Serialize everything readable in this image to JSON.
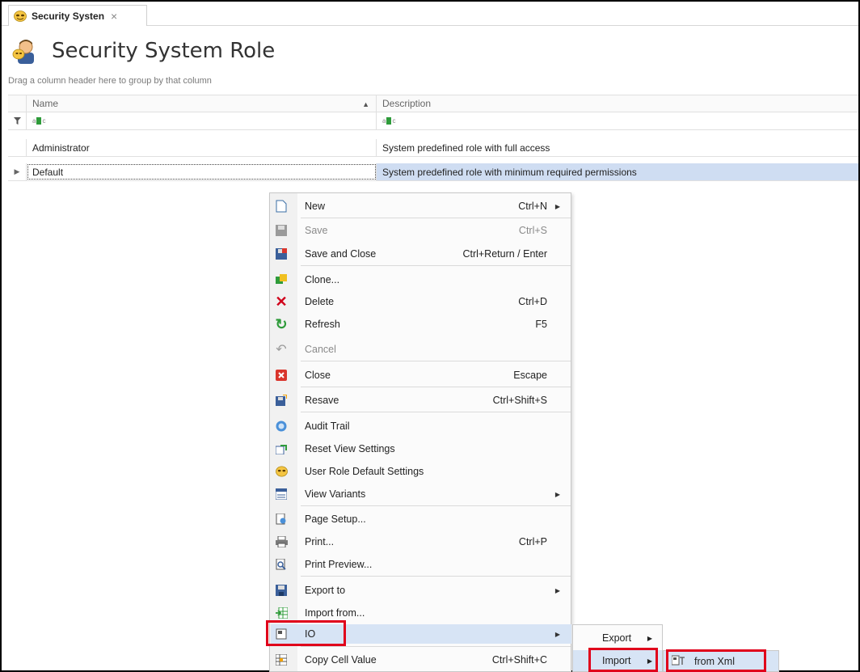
{
  "tab": {
    "label": "Security Systen",
    "close": "×"
  },
  "header": {
    "title": "Security System Role"
  },
  "group_panel": {
    "hint": "Drag a column header here to group by that column"
  },
  "grid": {
    "columns": [
      "Name",
      "Description"
    ],
    "filter_icon": "filter-icon",
    "rows": [
      {
        "name": "Administrator",
        "description": "System predefined role with full access"
      },
      {
        "name": "Default",
        "description": "System predefined role with minimum required permissions"
      }
    ]
  },
  "context_menu": {
    "items": [
      {
        "label": "New",
        "shortcut": "Ctrl+N",
        "submenu": true,
        "icon": "new-icon"
      },
      {
        "label": "Save",
        "shortcut": "Ctrl+S",
        "disabled": true,
        "icon": "save-icon"
      },
      {
        "label": "Save and Close",
        "shortcut": "Ctrl+Return / Enter",
        "icon": "save-close-icon"
      },
      {
        "label": "Clone...",
        "shortcut": "",
        "icon": "clone-icon"
      },
      {
        "label": "Delete",
        "shortcut": "Ctrl+D",
        "icon": "delete-icon"
      },
      {
        "label": "Refresh",
        "shortcut": "F5",
        "icon": "refresh-icon"
      },
      {
        "label": "Cancel",
        "shortcut": "",
        "disabled": true,
        "icon": "cancel-icon"
      },
      {
        "label": "Close",
        "shortcut": "Escape",
        "icon": "close-icon"
      },
      {
        "label": "Resave",
        "shortcut": "Ctrl+Shift+S",
        "icon": "resave-icon"
      },
      {
        "label": "Audit Trail",
        "shortcut": "",
        "icon": "audit-icon"
      },
      {
        "label": "Reset View Settings",
        "shortcut": "",
        "icon": "reset-view-icon"
      },
      {
        "label": "User Role Default Settings",
        "shortcut": "",
        "icon": "mask-icon"
      },
      {
        "label": "View Variants",
        "shortcut": "",
        "submenu": true,
        "icon": "view-variants-icon"
      },
      {
        "label": "Page Setup...",
        "shortcut": "",
        "icon": "page-setup-icon"
      },
      {
        "label": "Print...",
        "shortcut": "Ctrl+P",
        "icon": "print-icon"
      },
      {
        "label": "Print Preview...",
        "shortcut": "",
        "icon": "print-preview-icon"
      },
      {
        "label": "Export to",
        "shortcut": "",
        "submenu": true,
        "icon": "export-icon"
      },
      {
        "label": "Import from...",
        "shortcut": "",
        "icon": "import-icon"
      },
      {
        "label": "IO",
        "shortcut": "",
        "submenu": true,
        "highlighted": true,
        "icon": "io-icon"
      },
      {
        "label": "Copy Cell Value",
        "shortcut": "Ctrl+Shift+C",
        "icon": "copy-cell-icon"
      }
    ]
  },
  "io_submenu": {
    "export": "Export",
    "import": "Import"
  },
  "import_submenu": {
    "from_xml": "from Xml"
  },
  "colors": {
    "highlight": "#d7e4f5",
    "red_frame": "#e0001b",
    "selection": "#cfddf2"
  }
}
